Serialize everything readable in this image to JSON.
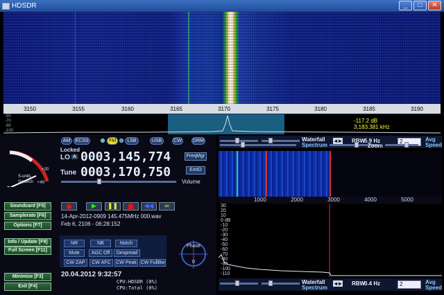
{
  "window": {
    "title": "HDSDR",
    "min": "_",
    "max": "□",
    "close": "✕"
  },
  "freq_scale": {
    "ticks": [
      "3150",
      "3155",
      "3160",
      "3165",
      "3170",
      "3175",
      "3180",
      "3185",
      "3190"
    ]
  },
  "spectrum": {
    "db_labels": [
      "-50",
      "-70",
      "-90",
      "-100"
    ],
    "readout_db": "-117.2 dB",
    "readout_khz": "3,183.381 kHz"
  },
  "modes": [
    "AM",
    "ECSS",
    "FM",
    "LSB",
    "USB",
    "CW",
    "DRM"
  ],
  "active_mode": "FM",
  "lo": {
    "locked_label": "Locked",
    "lo_label": "LO",
    "a_label": "A",
    "value": "0003,145,774"
  },
  "tune": {
    "label": "Tune",
    "value": "0003,170,750"
  },
  "buttons": {
    "freqmgr": "FreqMgr",
    "extio": "ExtIO",
    "volume": "Volume"
  },
  "smeter": {
    "scale_label": "S-units",
    "squelch": "Squelch",
    "plus20": "+20",
    "plus40": "+40"
  },
  "side_buttons": [
    {
      "label": "Soundcard  [F5]"
    },
    {
      "label": "Samplerate  [F6]"
    },
    {
      "label": "Options  [F7]"
    },
    {
      "label": "Info / Update  [F9]"
    },
    {
      "label": "Full Screen  [F11]"
    },
    {
      "label": "Minimize  [F3]"
    },
    {
      "label": "Exit  [F4]"
    }
  ],
  "recording": {
    "file": "14-Apr-2012-0909 145.475MHz 000.wav",
    "time": "Feb 6, 2106 - 06:28:152"
  },
  "dsp": {
    "nr": "NR",
    "nb": "NB",
    "notch": "Notch",
    "mute": "Mute",
    "agc": "AGC Off",
    "despread": "Despread",
    "cwzap": "CW ZAP",
    "cwafc": "CW AFC",
    "cwpeak": "CW Peak",
    "cwfullbw": "CW FullBw"
  },
  "phase": {
    "label": "Phase",
    "value": "0"
  },
  "status": {
    "datetime": "20.04.2012 9:32:57",
    "cpu_hdsdr": "CPU:HDSDR (0%)",
    "cpu_total": "CPU:Total (0%)"
  },
  "top_ctrl": {
    "waterfall": "Waterfall",
    "spectrum": "Spectrum",
    "rbw_label": "RBW",
    "rbw": "5.9 Hz",
    "zoom": "Zoom",
    "avg_val": "2",
    "avg": "Avg",
    "speed": "Speed"
  },
  "bottom_ctrl": {
    "waterfall": "Waterfall",
    "spectrum": "Spectrum",
    "rbw_label": "RBW",
    "rbw": "0.4 Hz",
    "avg_val": "2",
    "avg": "Avg",
    "speed": "Speed"
  },
  "zoom_scale": {
    "ticks": [
      "1000",
      "2000",
      "3000",
      "4000",
      "5000"
    ]
  },
  "zoom_db": [
    "30",
    "20",
    "10",
    "0 dB",
    "-10",
    "-20",
    "-30",
    "-40",
    "-50",
    "-60",
    "-70",
    "-80",
    "-90",
    "-100",
    "-110"
  ]
}
